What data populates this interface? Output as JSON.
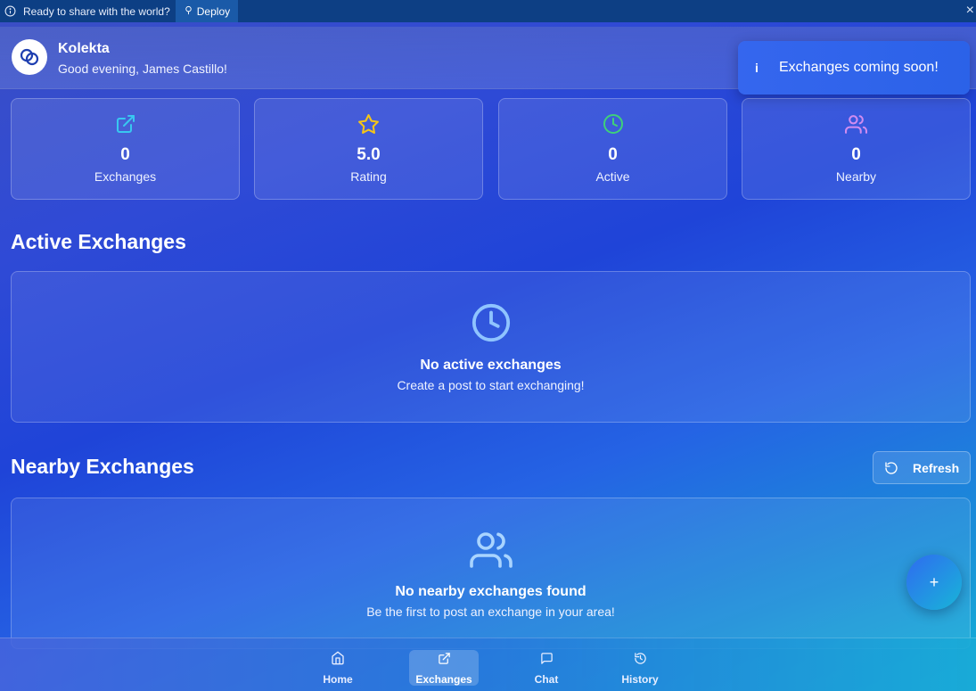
{
  "banner": {
    "text": "Ready to share with the world?",
    "deploy_label": "Deploy"
  },
  "header": {
    "app_name": "Kolekta",
    "greeting": "Good evening, James Castillo!"
  },
  "toast": {
    "icon": "info-icon",
    "text": "Exchanges coming soon!"
  },
  "stats": [
    {
      "value": "0",
      "label": "Exchanges",
      "icon": "external-link-icon",
      "color": "#38c8f0"
    },
    {
      "value": "5.0",
      "label": "Rating",
      "icon": "star-icon",
      "color": "#f5c518"
    },
    {
      "value": "0",
      "label": "Active",
      "icon": "clock-icon",
      "color": "#3fd07a"
    },
    {
      "value": "0",
      "label": "Nearby",
      "icon": "users-icon",
      "color": "#d08cf0"
    }
  ],
  "active_section": {
    "title": "Active Exchanges",
    "empty_title": "No active exchanges",
    "empty_sub": "Create a post to start exchanging!"
  },
  "nearby_section": {
    "title": "Nearby Exchanges",
    "refresh_label": "Refresh",
    "empty_title": "No nearby exchanges found",
    "empty_sub": "Be the first to post an exchange in your area!"
  },
  "fab": {
    "label": "+"
  },
  "nav": [
    {
      "label": "Home",
      "icon": "home-icon",
      "active": false
    },
    {
      "label": "Exchanges",
      "icon": "external-link-icon",
      "active": true
    },
    {
      "label": "Chat",
      "icon": "chat-icon",
      "active": false
    },
    {
      "label": "History",
      "icon": "history-icon",
      "active": false
    }
  ]
}
